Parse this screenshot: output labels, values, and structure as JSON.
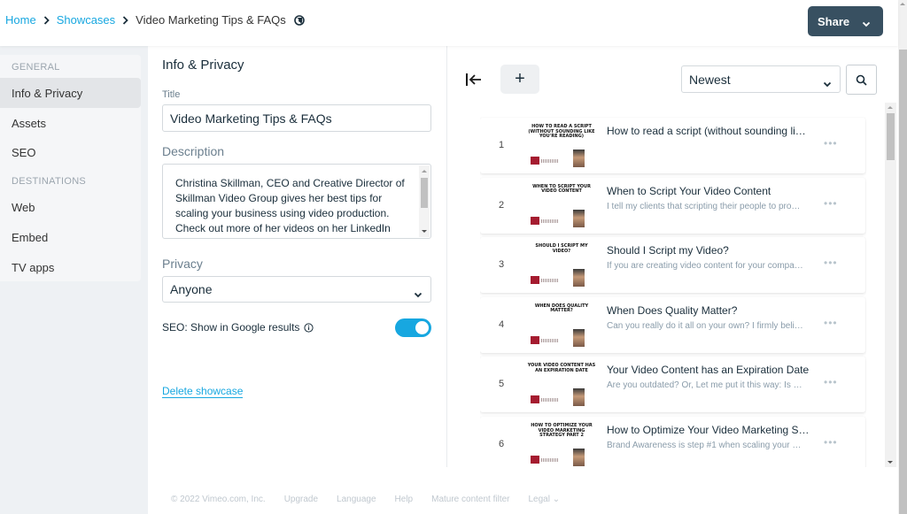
{
  "header": {
    "breadcrumb": [
      {
        "label": "Home",
        "link": true
      },
      {
        "label": "Showcases",
        "link": true
      },
      {
        "label": "Video Marketing Tips & FAQs",
        "link": false
      }
    ],
    "globe_icon": "globe-icon",
    "share_label": "Share"
  },
  "sidebar": {
    "sections": [
      {
        "title": "GENERAL",
        "items": [
          {
            "label": "Info & Privacy",
            "active": true
          },
          {
            "label": "Assets",
            "active": false
          },
          {
            "label": "SEO",
            "active": false
          }
        ]
      },
      {
        "title": "DESTINATIONS",
        "items": [
          {
            "label": "Web",
            "active": false
          },
          {
            "label": "Embed",
            "active": false
          },
          {
            "label": "TV apps",
            "active": false
          }
        ]
      }
    ]
  },
  "info": {
    "heading": "Info & Privacy",
    "title_label": "Title",
    "title_value": "Video Marketing Tips & FAQs",
    "description_label": "Description",
    "description_value": "Christina Skillman, CEO and Creative Director of Skillman Video Group gives her best tips for scaling your business using video production. Check out more of her videos on her LinkedIn",
    "privacy_label": "Privacy",
    "privacy_value": "Anyone",
    "seo_label": "SEO: Show in Google results",
    "seo_enabled": true,
    "delete_label": "Delete showcase"
  },
  "videos": {
    "sort_value": "Newest",
    "add_label": "+",
    "more_label": "•••",
    "items": [
      {
        "num": "1",
        "title": "How to read a script (without sounding li…",
        "desc": "",
        "thumb": "How to read a script (without sounding like you're reading)"
      },
      {
        "num": "2",
        "title": "When to Script Your Video Content",
        "desc": "I tell my clients that scripting their people to pro…",
        "thumb": "When to script your video content"
      },
      {
        "num": "3",
        "title": "Should I Script my Video?",
        "desc": "If you are creating video content for your compa…",
        "thumb": "Should I script my video?"
      },
      {
        "num": "4",
        "title": "When Does Quality Matter?",
        "desc": "Can you really do it all on your own? I firmly beli…",
        "thumb": "When does quality matter?"
      },
      {
        "num": "5",
        "title": "Your Video Content has an Expiration Date",
        "desc": "Are you outdated? Or, Let me put it this way: Is …",
        "thumb": "Your video content has an expiration date"
      },
      {
        "num": "6",
        "title": "How to Optimize Your Video Marketing S…",
        "desc": "Brand Awareness is step #1 when scaling your …",
        "thumb": "How to optimize your video marketing strategy part 2"
      }
    ]
  },
  "footer": {
    "copyright": "© 2022 Vimeo.com, Inc.",
    "links": [
      "Upgrade",
      "Language",
      "Help",
      "Mature content filter",
      "Legal ⌄"
    ]
  },
  "colors": {
    "accent": "#17a7e0",
    "share_button": "#385061",
    "text": "#1a2e3b",
    "muted": "#8a9caa"
  }
}
